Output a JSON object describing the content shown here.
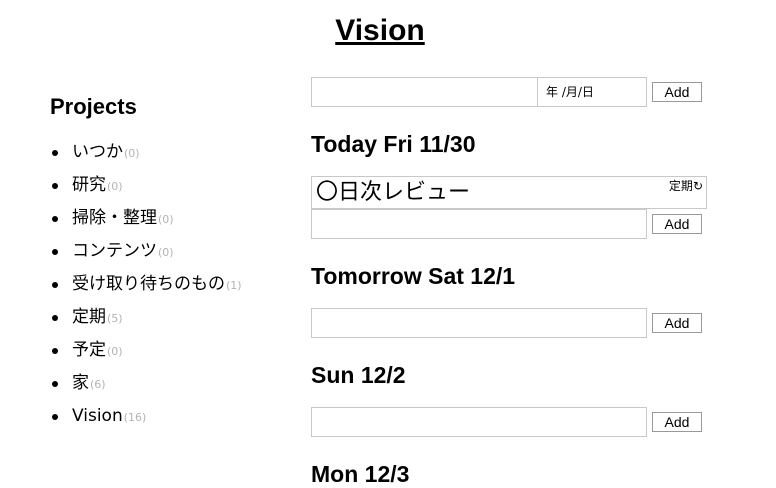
{
  "app": {
    "title": "Vision"
  },
  "sidebar": {
    "heading": "Projects",
    "items": [
      {
        "label": "いつか",
        "count": "(0)"
      },
      {
        "label": "研究",
        "count": "(0)"
      },
      {
        "label": "掃除・整理",
        "count": "(0)"
      },
      {
        "label": "コンテンツ",
        "count": "(0)"
      },
      {
        "label": "受け取り待ちのもの",
        "count": "(1)"
      },
      {
        "label": "定期",
        "count": "(5)"
      },
      {
        "label": "予定",
        "count": "(0)"
      },
      {
        "label": "家",
        "count": "(6)"
      },
      {
        "label": "Vision",
        "count": "(16)"
      }
    ]
  },
  "main": {
    "new_task": {
      "value": "",
      "date_placeholder": "年 /月/日",
      "add_label": "Add"
    },
    "days": [
      {
        "heading": "Today Fri 11/30",
        "task": {
          "title": "〇日次レビュー",
          "tag": "定期",
          "icon": "repeat-icon"
        },
        "input": {
          "value": "",
          "add_label": "Add"
        }
      },
      {
        "heading": "Tomorrow Sat 12/1",
        "input": {
          "value": "",
          "add_label": "Add"
        }
      },
      {
        "heading": "Sun 12/2",
        "input": {
          "value": "",
          "add_label": "Add"
        }
      },
      {
        "heading": "Mon 12/3"
      }
    ]
  }
}
